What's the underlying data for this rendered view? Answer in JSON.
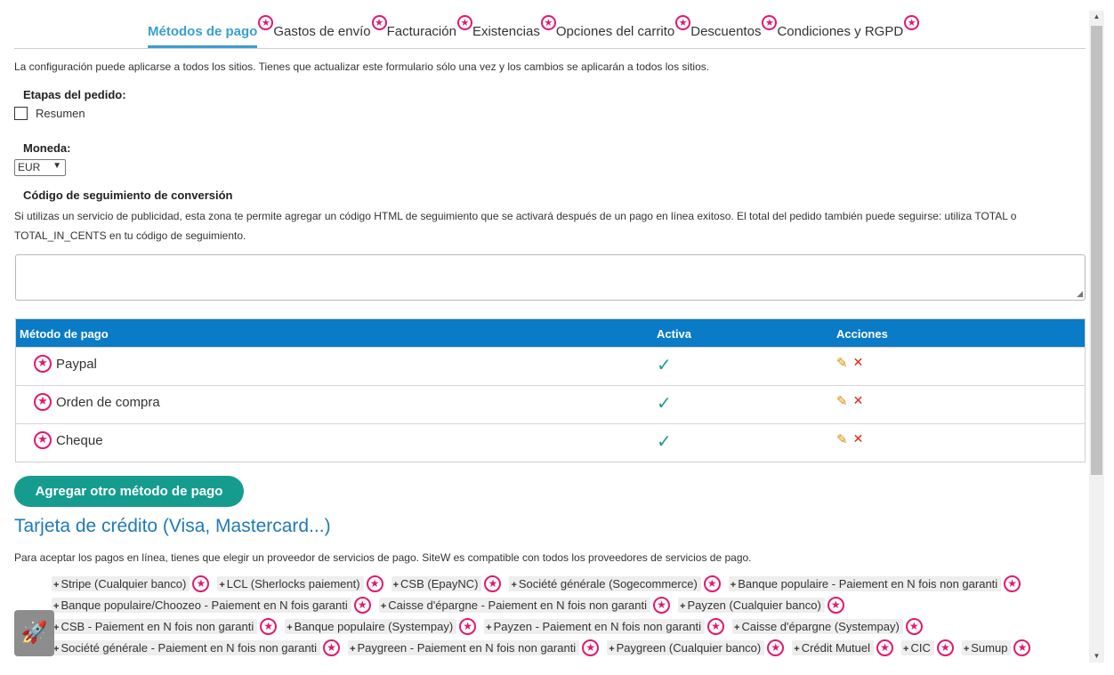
{
  "tabs": [
    {
      "label": "Métodos de pago"
    },
    {
      "label": "Gastos de envío"
    },
    {
      "label": "Facturación"
    },
    {
      "label": "Existencias"
    },
    {
      "label": "Opciones del carrito"
    },
    {
      "label": "Descuentos"
    },
    {
      "label": "Condiciones y RGPD"
    }
  ],
  "intro": "La configuración puede aplicarse a todos los sitios. Tienes que actualizar este formulario sólo una vez y los cambios se aplicarán a todos los sitios.",
  "order_steps": {
    "label": "Etapas del pedido:",
    "checkbox_label": "Resumen",
    "checked": false
  },
  "currency": {
    "label": "Moneda:",
    "value": "EUR"
  },
  "tracking": {
    "label": "Código de seguimiento de conversión",
    "description": "Si utilizas un servicio de publicidad, esta zona te permite agregar un código HTML de seguimiento que se activará después de un pago en línea exitoso. El total del pedido también puede seguirse: utiliza TOTAL o TOTAL_IN_CENTS en tu código de seguimiento.",
    "value": ""
  },
  "table": {
    "headers": {
      "method": "Método de pago",
      "active": "Activa",
      "actions": "Acciones"
    },
    "rows": [
      {
        "name": "Paypal",
        "active": true
      },
      {
        "name": "Orden de compra",
        "active": true
      },
      {
        "name": "Cheque",
        "active": true
      }
    ]
  },
  "add_button": "Agregar otro método de pago",
  "credit_card": {
    "title": "Tarjeta de crédito (Visa, Mastercard...)",
    "description": "Para aceptar los pagos en línea, tienes que elegir un proveedor de servicios de pago. SiteW es compatible con todos los proveedores de servicios de pago.",
    "providers": [
      "Stripe (Cualquier banco)",
      "LCL (Sherlocks paiement)",
      "CSB (EpayNC)",
      "Société générale (Sogecommerce)",
      "Banque populaire - Paiement en N fois non garanti",
      "Banque populaire/Choozeo - Paiement en N fois garanti",
      "Caisse d'épargne - Paiement en N fois non garanti",
      "Payzen (Cualquier banco)",
      "CSB - Paiement en N fois non garanti",
      "Banque populaire (Systempay)",
      "Payzen - Paiement en N fois non garanti",
      "Caisse d'épargne (Systempay)",
      "Société générale - Paiement en N fois non garanti",
      "Paygreen - Paiement en N fois non garanti",
      "Paygreen (Cualquier banco)",
      "Crédit Mutuel",
      "CIC",
      "Sumup"
    ]
  },
  "icons": {
    "badge": "star-badge-icon",
    "rocket": "rocket-icon",
    "edit": "pencil-icon",
    "delete": "close-icon",
    "check": "check-icon"
  },
  "colors": {
    "accent": "#3a9fd0",
    "table_header": "#0a7bc6",
    "button": "#169c8f",
    "badge": "#e3186e",
    "title": "#1f7ab8"
  }
}
